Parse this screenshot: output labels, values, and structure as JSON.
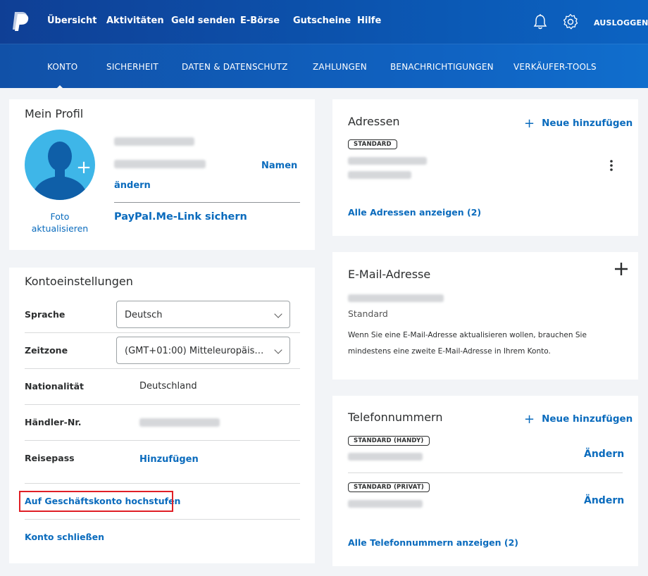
{
  "topnav": {
    "items": [
      "Übersicht",
      "Aktivitäten",
      "Geld senden",
      "E-Börse",
      "Gutscheine",
      "Hilfe"
    ],
    "logout": "AUSLOGGEN"
  },
  "subnav": {
    "items": [
      "KONTO",
      "SICHERHEIT",
      "DATEN & DATENSCHUTZ",
      "ZAHLUNGEN",
      "BENACHRICHTIGUNGEN",
      "VERKÄUFER-TOOLS"
    ],
    "active": "KONTO"
  },
  "profile": {
    "title": "Mein Profil",
    "photo_label_1": "Foto",
    "photo_label_2": "aktualisieren",
    "name_link_1": "Namen",
    "name_link_2": "ändern",
    "paypalme": "PayPal.Me-Link sichern"
  },
  "settings": {
    "title": "Kontoeinstellungen",
    "language_label": "Sprache",
    "language_value": "Deutsch",
    "timezone_label": "Zeitzone",
    "timezone_value": "(GMT+01:00) Mitteleuropäische...",
    "nationality_label": "Nationalität",
    "nationality_value": "Deutschland",
    "merchant_label": "Händler-Nr.",
    "passport_label": "Reisepass",
    "passport_link": "Hinzufügen",
    "upgrade_link": "Auf Geschäftskonto hochstufen",
    "close_link": "Konto schließen"
  },
  "addresses": {
    "title": "Adressen",
    "add_link": "Neue hinzufügen",
    "badge": "STANDARD",
    "show_all": "Alle Adressen anzeigen (2)"
  },
  "email": {
    "title": "E-Mail-Adresse",
    "status": "Standard",
    "note_1": "Wenn Sie eine E-Mail-Adresse aktualisieren wollen, brauchen Sie",
    "note_2": "mindestens eine zweite E-Mail-Adresse in Ihrem Konto."
  },
  "phones": {
    "title": "Telefonnummern",
    "add_link": "Neue hinzufügen",
    "badge_mobile": "STANDARD (HANDY)",
    "badge_home": "STANDARD (PRIVAT)",
    "edit": "Ändern",
    "show_all": "Alle Telefonnummern anzeigen (2)"
  },
  "colors": {
    "brand_dark": "#0f3f95",
    "brand": "#0c63c2",
    "link": "#0a6bbd",
    "avatar": "#3eb6e8",
    "highlight": "#e01f26"
  }
}
